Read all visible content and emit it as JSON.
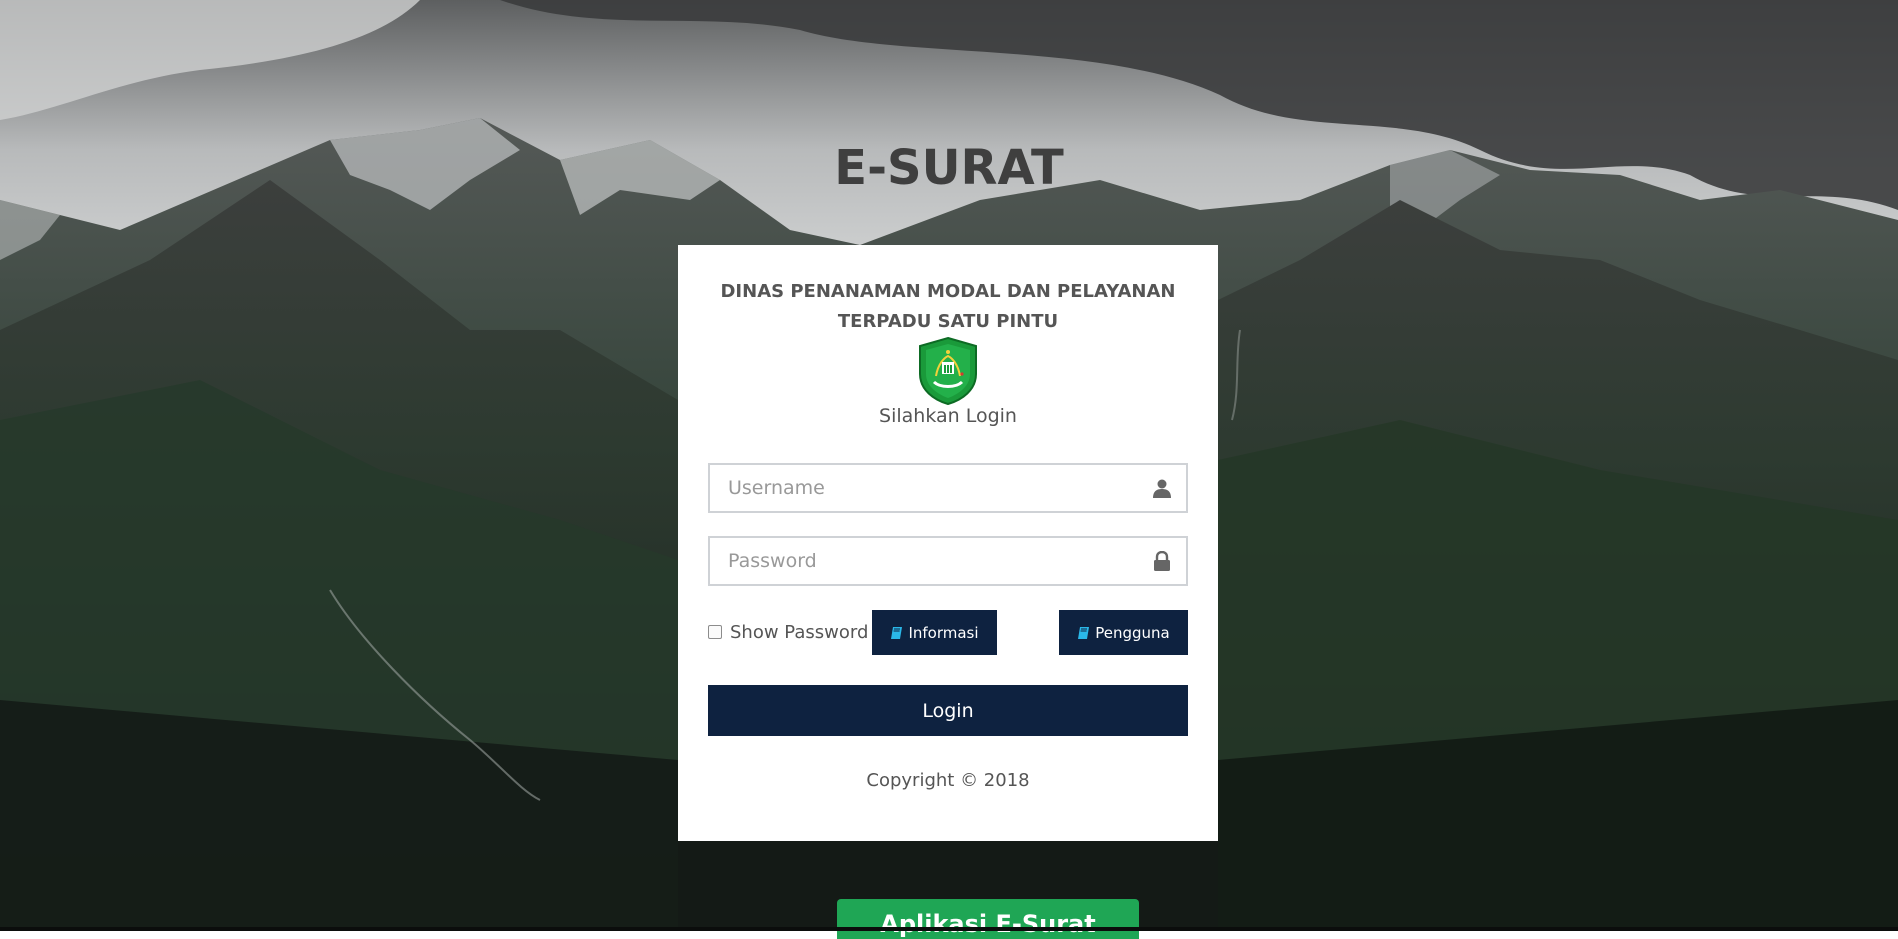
{
  "app_title": "E-SURAT",
  "card": {
    "agency_line1": "DINAS PENANAMAN MODAL DAN PELAYANAN",
    "agency_line2": "TERPADU SATU PINTU",
    "logo_icon": "regional-emblem-icon",
    "subtitle": "Silahkan Login",
    "username": {
      "value": "",
      "placeholder": "Username",
      "icon": "user-icon"
    },
    "password": {
      "value": "",
      "placeholder": "Password",
      "icon": "lock-icon"
    },
    "show_password_label": "Show Password",
    "show_password_checked": false,
    "informasi_label": "Informasi",
    "pengguna_label": "Pengguna",
    "button_icon": "book-icon",
    "login_label": "Login",
    "copyright": "Copyright © 2018"
  },
  "footer_badge": "Aplikasi E-Surat Online",
  "colors": {
    "primary_button": "#0e2240",
    "badge_green": "#1fa655",
    "book_icon": "#2ab7e8"
  }
}
